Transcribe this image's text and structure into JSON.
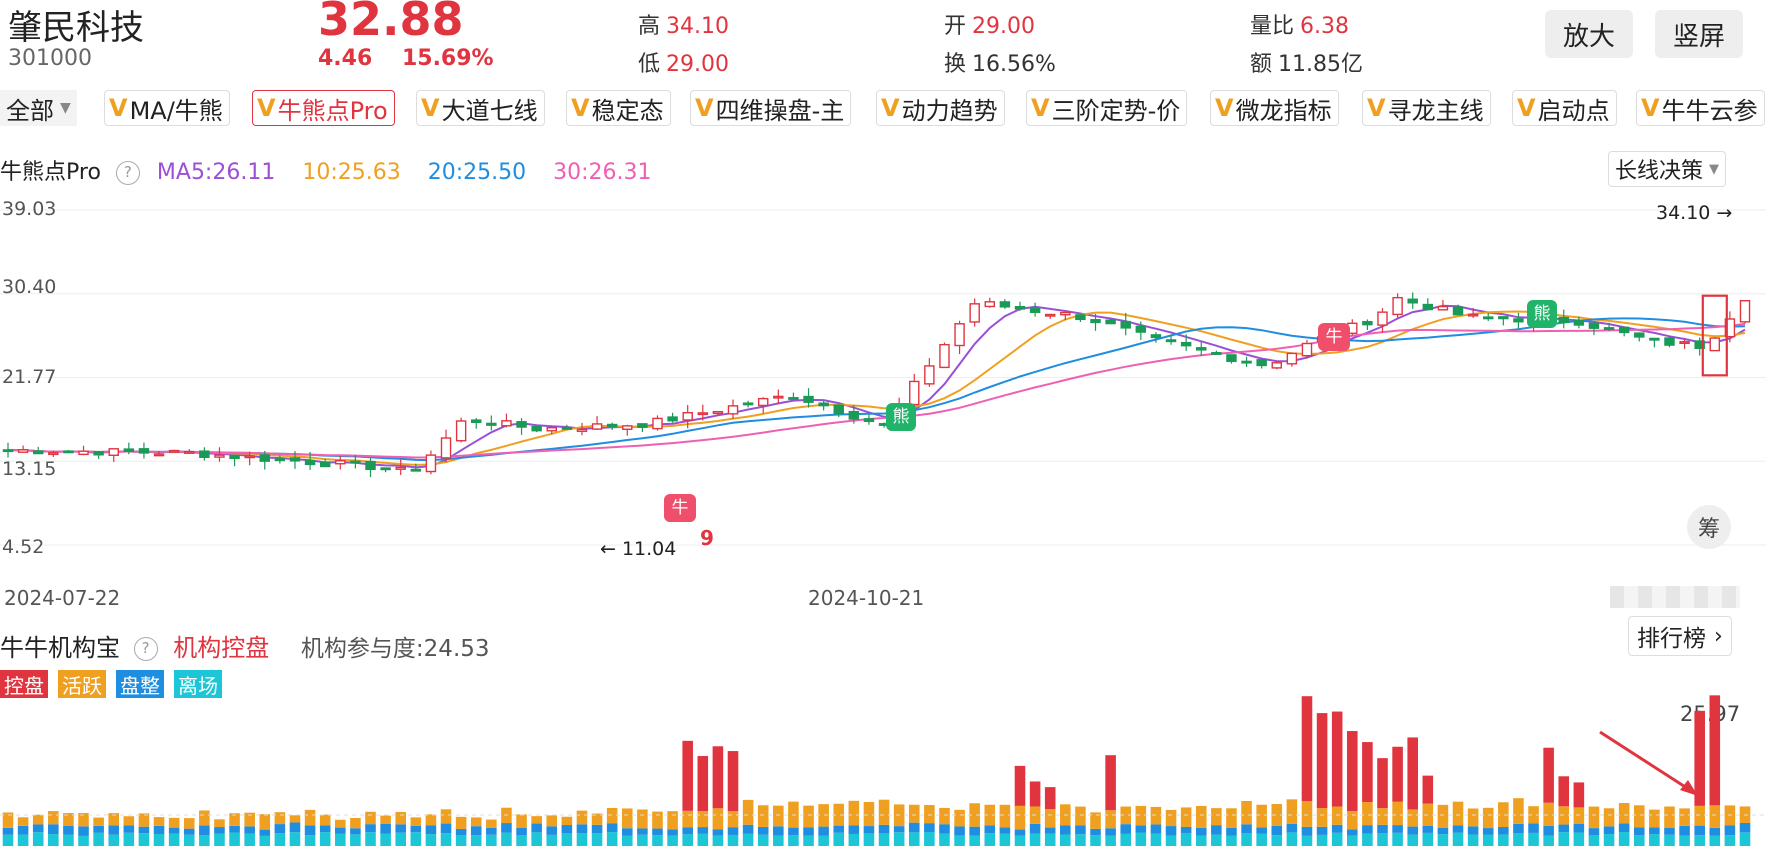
{
  "header": {
    "stock_name": "肇民科技",
    "stock_code": "301000",
    "price": "32.88",
    "change": "4.46",
    "change_pct": "15.69%",
    "high_label": "高",
    "high": "34.10",
    "low_label": "低",
    "low": "29.00",
    "open_label": "开",
    "open": "29.00",
    "turnover_label": "换",
    "turnover": "16.56%",
    "vol_ratio_label": "量比",
    "vol_ratio": "6.38",
    "amount_label": "额",
    "amount": "11.85亿",
    "zoom_button": "放大",
    "portrait_button": "竖屏"
  },
  "tabs": {
    "all_label": "全部",
    "items": [
      {
        "label": "MA/牛熊"
      },
      {
        "label": "牛熊点Pro"
      },
      {
        "label": "大道七线"
      },
      {
        "label": "稳定态"
      },
      {
        "label": "四维操盘-主"
      },
      {
        "label": "动力趋势"
      },
      {
        "label": "三阶定势-价"
      },
      {
        "label": "微龙指标"
      },
      {
        "label": "寻龙主线"
      },
      {
        "label": "启动点"
      },
      {
        "label": "牛牛云参"
      }
    ],
    "active_index": 1,
    "v_mark": "V"
  },
  "indicator_legend": {
    "name": "牛熊点Pro",
    "help": "?",
    "ma5": "MA5:26.11",
    "ma10": "10:25.63",
    "ma20": "20:25.50",
    "ma30": "30:26.31",
    "mode_select": "长线决策"
  },
  "colors": {
    "up": "#e0343f",
    "down": "#1a9a57",
    "ma5": "#9b4fd6",
    "ma10": "#f0a020",
    "ma20": "#1f8de0",
    "ma30": "#ef5fb3",
    "kong": "#e0343f",
    "huo": "#f0a020",
    "pan": "#1f8de0",
    "li": "#1cc6d6"
  },
  "price_chart": {
    "y_ticks": [
      "39.03",
      "30.40",
      "21.77",
      "13.15",
      "4.52"
    ],
    "high_marker": "34.10 →",
    "low_marker": "← 11.04",
    "bull_label": "牛",
    "bear_label": "熊",
    "chip_button": "筹",
    "date_start": "2024-07-22",
    "date_mid": "2024-10-21",
    "nine_mark": "9"
  },
  "institution": {
    "title": "牛牛机构宝",
    "help": "?",
    "subtitle": "机构控盘",
    "participation": "机构参与度:24.53",
    "rank_button": "排行榜",
    "badges": [
      "控盘",
      "活跃",
      "盘整",
      "离场"
    ],
    "max_value": "25.97"
  },
  "chart_data": {
    "type": "candlestick",
    "ylim": [
      4.52,
      39.03
    ],
    "y_ticks": [
      39.03,
      30.4,
      21.77,
      13.15,
      4.52
    ],
    "x_labels": [
      "2024-07-22",
      "2024-10-21"
    ],
    "high_annotation": 34.1,
    "low_annotation": 11.04,
    "ma": {
      "MA5": 26.11,
      "MA10": 25.63,
      "MA20": 25.5,
      "MA30": 26.31
    },
    "last_price": 32.88
  }
}
